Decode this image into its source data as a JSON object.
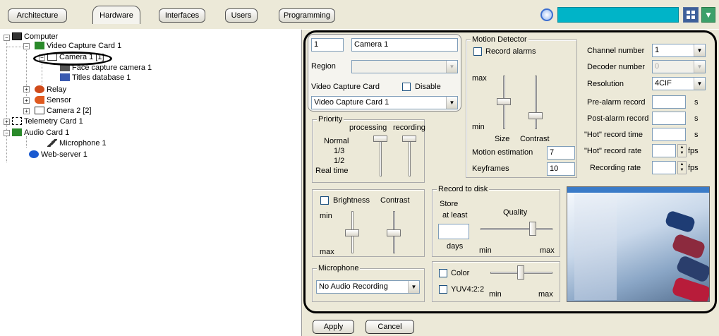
{
  "tabs": [
    "Architecture",
    "Hardware",
    "Interfaces",
    "Users",
    "Programming"
  ],
  "tree": {
    "computer": "Computer",
    "vcc": "Video Capture Card 1",
    "camera1": "Camera 1 [1]",
    "face": "Face capture camera 1",
    "titles": "Titles database 1",
    "relay": "Relay",
    "sensor": "Sensor",
    "camera2": "Camera 2 [2]",
    "telemetry": "Telemetry Card 1",
    "audio": "Audio Card 1",
    "microphone": "Microphone 1",
    "webserver": "Web-server 1"
  },
  "camera": {
    "id": "1",
    "name": "Camera 1",
    "region_label": "Region",
    "region_value": "",
    "vcc_label": "Video Capture Card",
    "disable_label": "Disable",
    "vcc_value": "Video Capture Card 1"
  },
  "priority": {
    "title": "Priority",
    "processing": "processing",
    "recording": "recording",
    "levels": [
      "Normal",
      "1/3",
      "1/2",
      "Real time"
    ]
  },
  "motion": {
    "title": "Motion Detector",
    "record_alarms": "Record alarms",
    "max": "max",
    "min": "min",
    "size": "Size",
    "contrast": "Contrast",
    "estimation_label": "Motion estimation",
    "estimation_value": "7",
    "keyframes_label": "Keyframes",
    "keyframes_value": "10"
  },
  "settings": {
    "channel_label": "Channel number",
    "channel_value": "1",
    "decoder_label": "Decoder number",
    "decoder_value": "0",
    "resolution_label": "Resolution",
    "resolution_value": "4CIF",
    "pre_label": "Pre-alarm record",
    "post_label": "Post-alarm record",
    "hot_time_label": "\"Hot\" record time",
    "hot_rate_label": "\"Hot\" record rate",
    "rate_label": "Recording rate",
    "s": "s",
    "fps": "fps"
  },
  "image": {
    "brightness": "Brightness",
    "contrast": "Contrast",
    "min": "min",
    "max": "max"
  },
  "disk": {
    "title": "Record to disk",
    "store": "Store",
    "at_least": "at least",
    "quality": "Quality",
    "days": "days",
    "min": "min",
    "max": "max"
  },
  "mic": {
    "title": "Microphone",
    "value": "No Audio Recording"
  },
  "color": {
    "color": "Color",
    "yuv": "YUV4:2:2",
    "min": "min",
    "max": "max"
  },
  "buttons": {
    "apply": "Apply",
    "cancel": "Cancel"
  },
  "colors": {
    "accent": "#00b4c8",
    "bg": "#ece9d8",
    "outline": "#000000"
  }
}
